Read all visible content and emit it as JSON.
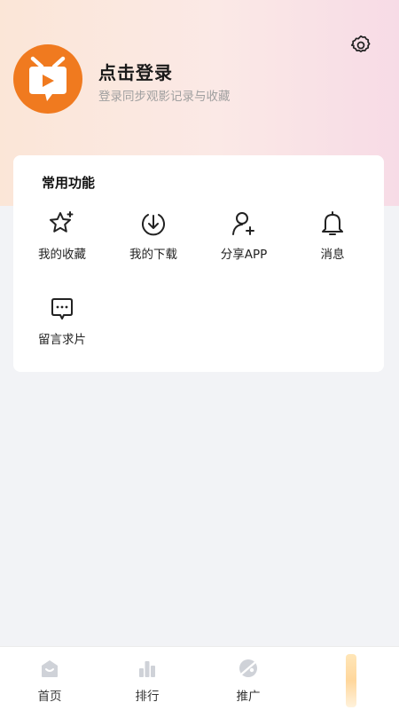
{
  "profile": {
    "login_title": "点击登录",
    "login_subtitle": "登录同步观影记录与收藏"
  },
  "common": {
    "title": "常用功能",
    "items": [
      {
        "label": "我的收藏",
        "icon": "star-sparkle-icon"
      },
      {
        "label": "我的下载",
        "icon": "download-icon"
      },
      {
        "label": "分享APP",
        "icon": "add-person-icon"
      },
      {
        "label": "消息",
        "icon": "bell-icon"
      },
      {
        "label": "留言求片",
        "icon": "message-bubble-icon"
      }
    ]
  },
  "tabbar": {
    "items": [
      {
        "label": "首页",
        "icon": "home-icon"
      },
      {
        "label": "排行",
        "icon": "chart-bars-icon"
      },
      {
        "label": "推广",
        "icon": "promote-icon"
      },
      {
        "label": "",
        "icon": "mine-icon"
      }
    ]
  },
  "colors": {
    "brand_orange": "#f07a1f",
    "hero_left": "#fbe6d7",
    "hero_right": "#f7dbe6",
    "tab_inactive": "#cfd2d8"
  }
}
